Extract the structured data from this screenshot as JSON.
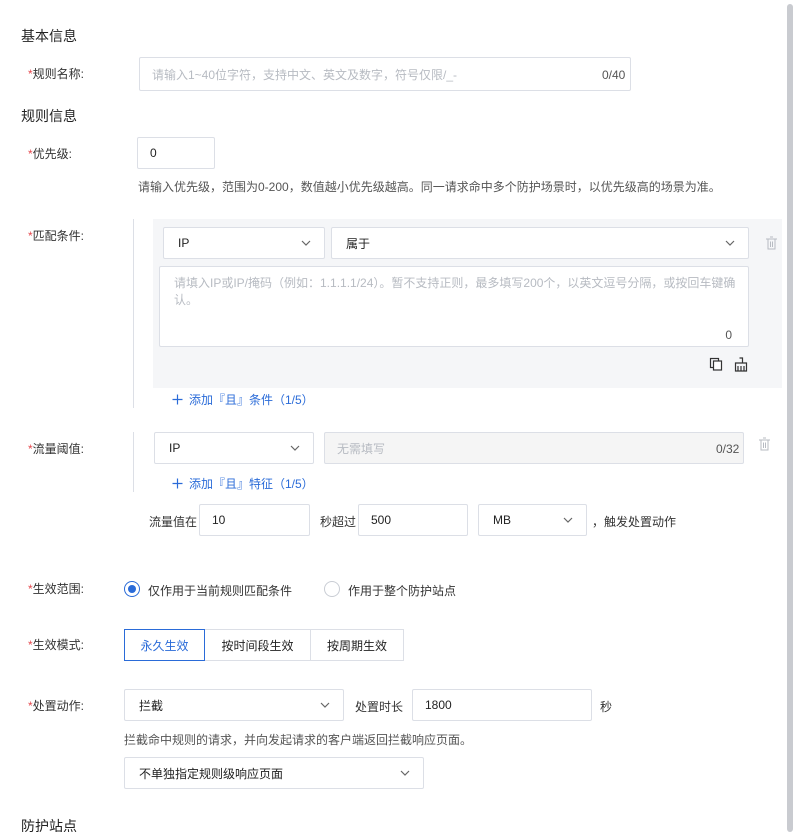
{
  "basic_info": {
    "title": "基本信息",
    "rule_name": {
      "required": "*",
      "label": "规则名称:",
      "placeholder": "请输入1~40位字符，支持中文、英文及数字，符号仅限/_-",
      "count": "0/40"
    }
  },
  "rule_info": {
    "title": "规则信息",
    "priority": {
      "required": "*",
      "label": "优先级:",
      "value": "0",
      "help": "请输入优先级，范围为0-200，数值越小优先级越高。同一请求命中多个防护场景时，以优先级高的场景为准。"
    },
    "match": {
      "required": "*",
      "label": "匹配条件:",
      "field": "IP",
      "operator": "属于",
      "textarea_placeholder": "请填入IP或IP/掩码（例如：1.1.1.1/24）。暂不支持正则，最多填写200个，以英文逗号分隔，或按回车键确认。",
      "textarea_count": "0",
      "add_label": "添加『且』条件（1/5）"
    },
    "threshold": {
      "required": "*",
      "label": "流量阈值:",
      "field": "IP",
      "value_placeholder": "无需填写",
      "value_count": "0/32",
      "add_label": "添加『且』特征（1/5）",
      "prefix": "流量值在",
      "seconds": "10",
      "mid": "秒超过",
      "amount": "500",
      "unit": "MB",
      "suffix": "，触发处置动作"
    },
    "scope": {
      "required": "*",
      "label": "生效范围:",
      "options": [
        "仅作用于当前规则匹配条件",
        "作用于整个防护站点"
      ],
      "selected": 0
    },
    "mode": {
      "required": "*",
      "label": "生效模式:",
      "options": [
        "永久生效",
        "按时间段生效",
        "按周期生效"
      ],
      "selected": 0
    },
    "action": {
      "required": "*",
      "label": "处置动作:",
      "value": "拦截",
      "duration_label": "处置时长",
      "duration": "1800",
      "duration_unit": "秒",
      "help": "拦截命中规则的请求，并向发起请求的客户端返回拦截响应页面。",
      "response_page": "不单独指定规则级响应页面"
    }
  },
  "protected_sites": {
    "title": "防护站点"
  },
  "colors": {
    "accent": "#2a6bd8",
    "required": "#e5484d"
  },
  "icons": {
    "chevron": "chevron-down-icon",
    "delete": "trash-icon",
    "copy": "copy-icon",
    "clear": "broom-icon",
    "plus": "plus-icon"
  }
}
